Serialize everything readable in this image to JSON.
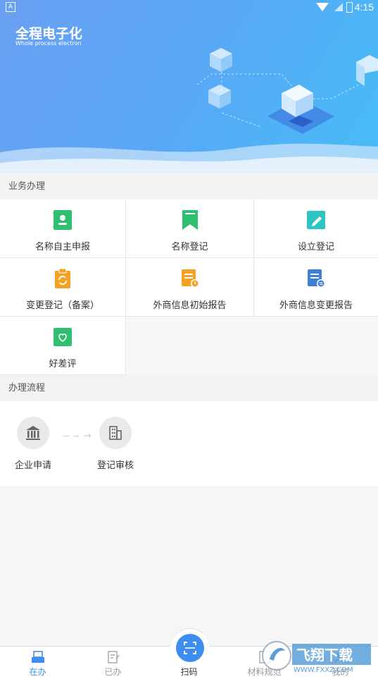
{
  "status_bar": {
    "time": "4:15"
  },
  "hero": {
    "title": "全程电子化",
    "subtitle": "Whole process electron"
  },
  "business": {
    "title": "业务办理",
    "items": [
      {
        "label": "名称自主申报",
        "icon": "id-book-icon",
        "color": "#2fbf71"
      },
      {
        "label": "名称登记",
        "icon": "bookmark-icon",
        "color": "#2fbf71"
      },
      {
        "label": "设立登记",
        "icon": "edit-ticket-icon",
        "color": "#2ec4c4"
      },
      {
        "label": "变更登记（备案）",
        "icon": "clipboard-refresh-icon",
        "color": "#f5a123"
      },
      {
        "label": "外商信息初始报告",
        "icon": "document-clock-icon",
        "color": "#f5a123"
      },
      {
        "label": "外商信息变更报告",
        "icon": "document-swap-icon",
        "color": "#3d7fd6"
      },
      {
        "label": "好差评",
        "icon": "heart-badge-icon",
        "color": "#2fbf71"
      }
    ]
  },
  "process": {
    "title": "办理流程",
    "steps": [
      {
        "label": "企业申请",
        "icon": "bank-building-icon"
      },
      {
        "label": "登记审核",
        "icon": "office-building-icon"
      }
    ]
  },
  "tabbar": {
    "tabs": [
      {
        "label": "在办",
        "icon": "inbox-icon",
        "active": true
      },
      {
        "label": "已办",
        "icon": "done-document-icon",
        "active": false
      },
      {
        "label": "扫码",
        "icon": "scan-icon",
        "active": false
      },
      {
        "label": "材料规范",
        "icon": "material-icon",
        "active": false
      },
      {
        "label": "我的",
        "icon": "user-icon",
        "active": false
      }
    ]
  },
  "watermark": {
    "text_cn": "飞翔下载",
    "text_en": "WWW.FXXZ.COM"
  },
  "colors": {
    "accent": "#3d8ef0",
    "hero_start": "#6aa0f2",
    "hero_end": "#46bdf6"
  }
}
